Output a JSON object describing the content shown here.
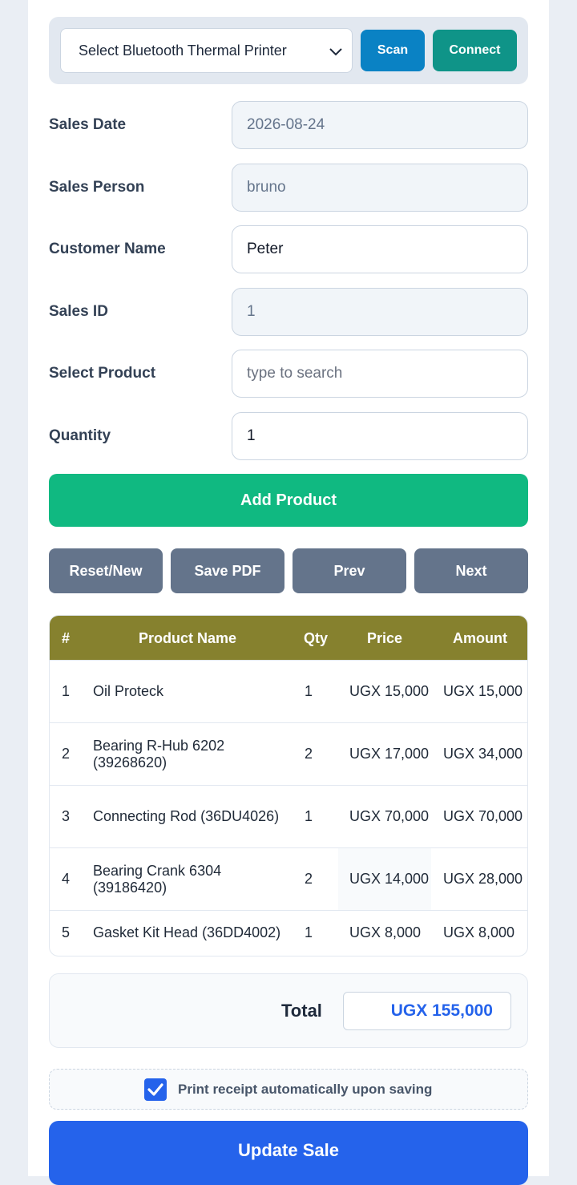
{
  "printer": {
    "select_label": "Select Bluetooth Thermal Printer",
    "scan_label": "Scan",
    "connect_label": "Connect"
  },
  "form": {
    "sales_date": {
      "label": "Sales Date",
      "value": "2026-08-24"
    },
    "sales_person": {
      "label": "Sales Person",
      "value": "bruno"
    },
    "customer_name": {
      "label": "Customer Name",
      "value": "Peter"
    },
    "sales_id": {
      "label": "Sales ID",
      "value": "1"
    },
    "select_product": {
      "label": "Select Product",
      "placeholder": "type to search"
    },
    "quantity": {
      "label": "Quantity",
      "value": "1"
    }
  },
  "actions": {
    "add_product": "Add Product",
    "reset_new": "Reset/New",
    "save_pdf": "Save PDF",
    "prev": "Prev",
    "next": "Next"
  },
  "table": {
    "headers": [
      "#",
      "Product Name",
      "Qty",
      "Price",
      "Amount"
    ],
    "rows": [
      [
        "1",
        "Oil Proteck",
        "1",
        "UGX 15,000",
        "UGX 15,000"
      ],
      [
        "2",
        "Bearing R-Hub 6202 (39268620)",
        "2",
        "UGX 17,000",
        "UGX 34,000"
      ],
      [
        "3",
        "Connecting Rod (36DU4026)",
        "1",
        "UGX 70,000",
        "UGX 70,000"
      ],
      [
        "4",
        "Bearing Crank 6304 (39186420)",
        "2",
        "UGX 14,000",
        "UGX 28,000"
      ],
      [
        "5",
        "Gasket Kit Head (36DD4002)",
        "1",
        "UGX 8,000",
        "UGX 8,000"
      ]
    ]
  },
  "total": {
    "label": "Total",
    "value": "UGX 155,000"
  },
  "print_option": {
    "label": "Print receipt automatically upon saving",
    "checked": true
  },
  "update_label": "Update Sale",
  "colors": {
    "scan": "#0a82c4",
    "connect": "#0f9488",
    "add_product": "#10b981",
    "nav_buttons": "#64748b",
    "table_header": "#86812e",
    "total_text": "#2563eb",
    "update": "#2563eb"
  }
}
